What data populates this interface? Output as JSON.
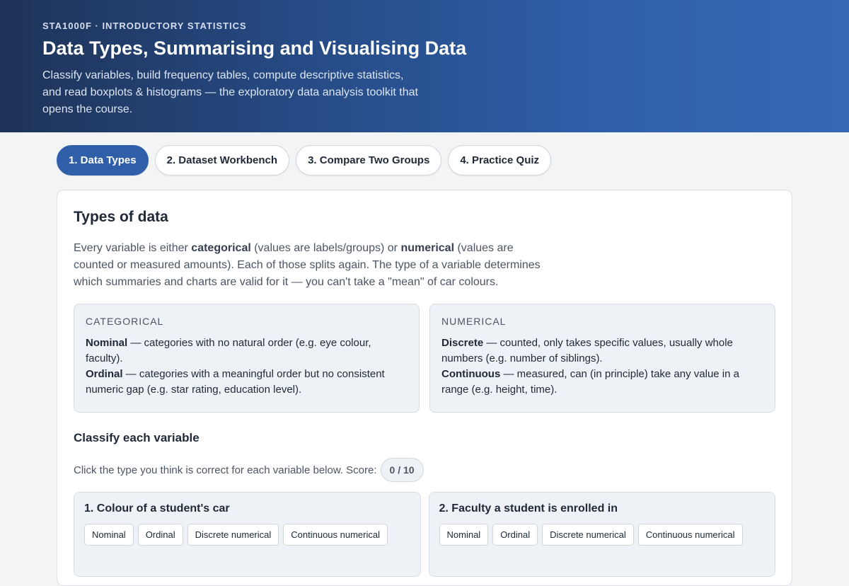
{
  "header": {
    "eyebrow": "STA1000F · INTRODUCTORY STATISTICS",
    "title": "Data Types, Summarising and Visualising Data",
    "subtitle": "Classify variables, build frequency tables, compute descriptive statistics, and read boxplots & histograms — the exploratory data analysis toolkit that opens the course."
  },
  "tabs": [
    {
      "label": "1. Data Types",
      "active": true
    },
    {
      "label": "2. Dataset Workbench",
      "active": false
    },
    {
      "label": "3. Compare Two Groups",
      "active": false
    },
    {
      "label": "4. Practice Quiz",
      "active": false
    }
  ],
  "section": {
    "title": "Types of data",
    "intro": {
      "p1": "Every variable is either ",
      "b1": "categorical",
      "p2": " (values are labels/groups) or ",
      "b2": "numerical",
      "p3": " (values are counted or measured amounts). Each of those splits again. The type of a variable determines which summaries and charts are valid for it — you can't take a \"mean\" of car colours."
    },
    "categorical": {
      "heading": "CATEGORICAL",
      "nominal_term": "Nominal",
      "nominal_desc": " — categories with no natural order (e.g. eye colour, faculty).",
      "ordinal_term": "Ordinal",
      "ordinal_desc": " — categories with a meaningful order but no consistent numeric gap (e.g. star rating, education level)."
    },
    "numerical": {
      "heading": "NUMERICAL",
      "discrete_term": "Discrete",
      "discrete_desc": " — counted, only takes specific values, usually whole numbers (e.g. number of siblings).",
      "continuous_term": "Continuous",
      "continuous_desc": " — measured, can (in principle) take any value in a range (e.g. height, time)."
    }
  },
  "classify": {
    "title": "Classify each variable",
    "instruction": "Click the type you think is correct for each variable below. Score:",
    "score": "0 / 10",
    "options": [
      "Nominal",
      "Ordinal",
      "Discrete numerical",
      "Continuous numerical"
    ],
    "questions": [
      {
        "label": "1. Colour of a student's car"
      },
      {
        "label": "2. Faculty a student is enrolled in"
      }
    ]
  }
}
